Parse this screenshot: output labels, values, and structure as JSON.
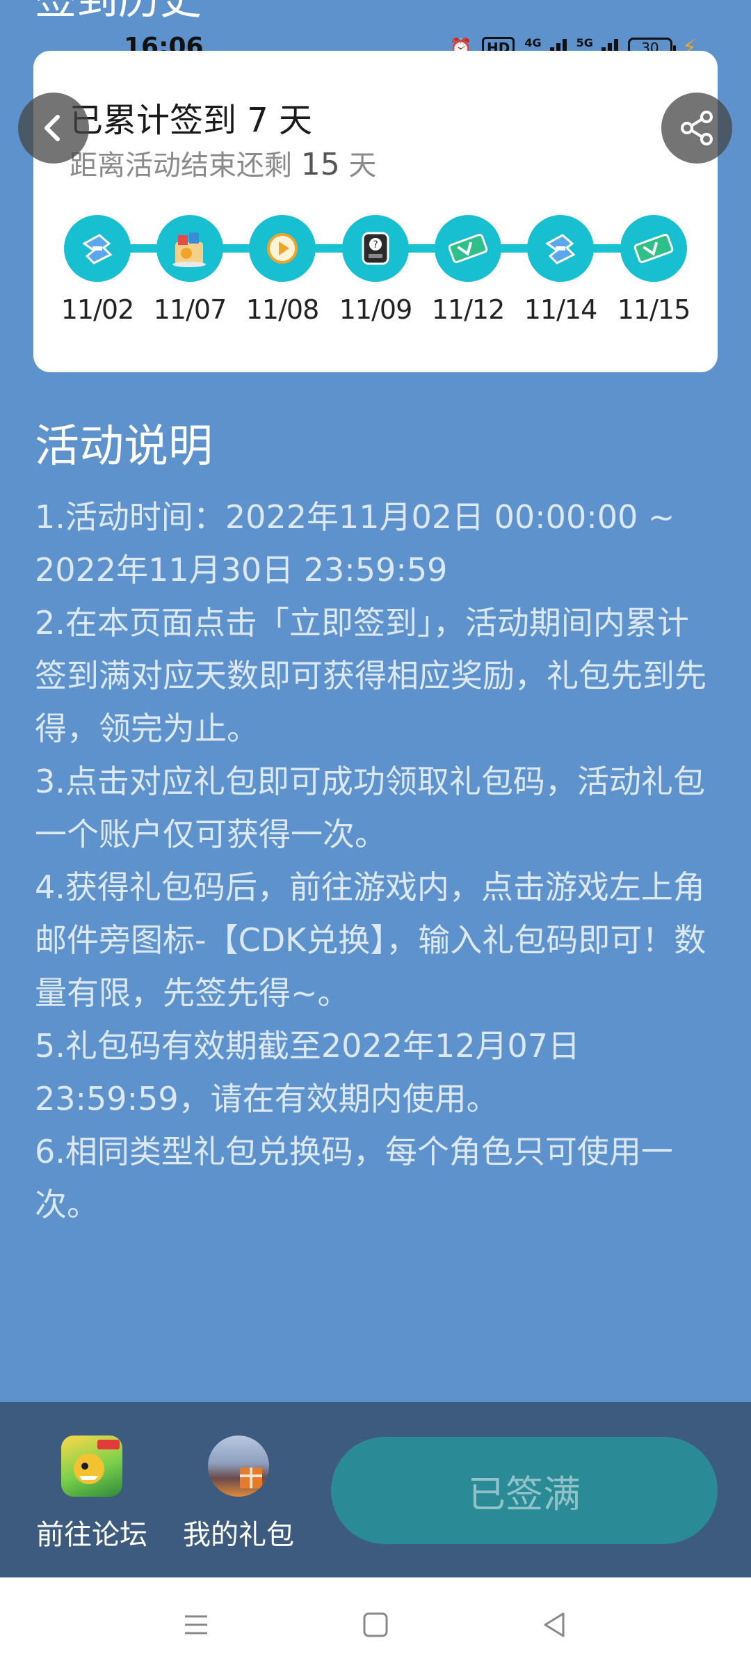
{
  "header": {
    "page_title": "签到历史"
  },
  "status_bar": {
    "time": "16:06",
    "hd_label": "HD",
    "net_4g": "4G",
    "net_5g": "5G",
    "battery": "30"
  },
  "summary": {
    "title": "已累计签到 7 天",
    "subtitle_prefix": "距离活动结束还剩 ",
    "days_left": "15",
    "subtitle_suffix": " 天"
  },
  "milestones": [
    {
      "date": "11/02",
      "icon": "ticket-blue-icon"
    },
    {
      "date": "11/07",
      "icon": "gift-bag-icon"
    },
    {
      "date": "11/08",
      "icon": "play-coin-icon"
    },
    {
      "date": "11/09",
      "icon": "mystery-box-icon"
    },
    {
      "date": "11/12",
      "icon": "green-ticket-icon"
    },
    {
      "date": "11/14",
      "icon": "ticket-blue-icon"
    },
    {
      "date": "11/15",
      "icon": "green-ticket-icon"
    }
  ],
  "rules": {
    "title": "活动说明",
    "items": [
      "1.活动时间：2022年11月02日 00:00:00 ~ 2022年11月30日 23:59:59",
      "2.在本页面点击「立即签到」，活动期间内累计签到满对应天数即可获得相应奖励，礼包先到先得，领完为止。",
      "3.点击对应礼包即可成功领取礼包码，活动礼包一个账户仅可获得一次。",
      "4.获得礼包码后，前往游戏内，点击游戏左上角邮件旁图标-【CDK兑换】，输入礼包码即可！数量有限，先签先得~。",
      "5.礼包码有效期截至2022年12月07日 23:59:59，请在有效期内使用。",
      "6.相同类型礼包兑换码，每个角色只可使用一次。"
    ]
  },
  "actions": {
    "forum_label": "前往论坛",
    "gift_label": "我的礼包",
    "signed_label": "已签满"
  },
  "colors": {
    "page_bg": "#5e92cc",
    "accent_teal": "#18bfd0",
    "bottom_bar": "#3d5b7f",
    "signed_button": "#2a8a96"
  }
}
